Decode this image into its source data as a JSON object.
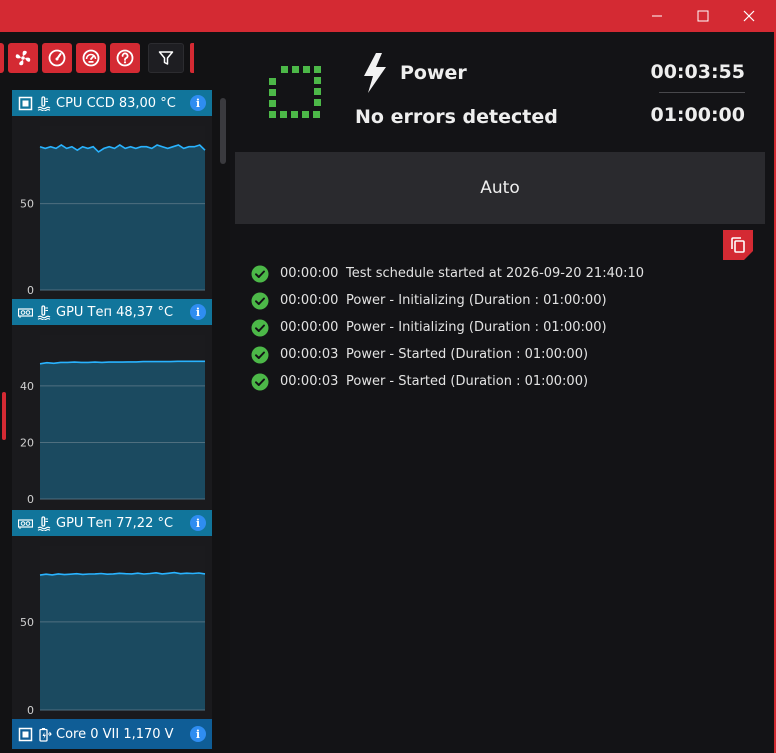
{
  "window": {
    "minimize_icon": "minimize-icon",
    "maximize_icon": "maximize-icon",
    "close_icon": "close-icon",
    "accent": "#d42a33"
  },
  "toolbar": {
    "icons": [
      "fan-icon",
      "gauge-icon",
      "speedometer-icon",
      "help-icon",
      "filter-icon"
    ]
  },
  "sensors": [
    {
      "icon": "cpu-chip-icon",
      "type_icon": "temperature-icon",
      "label": "CPU CCD 83,00 °C",
      "header_color": "#11759b",
      "ticks": [
        "50",
        "0"
      ]
    },
    {
      "icon": "gpu-card-icon",
      "type_icon": "temperature-icon",
      "label": "GPU Теп 48,37 °C",
      "header_color": "#11759b",
      "ticks": [
        "40",
        "20",
        "0"
      ]
    },
    {
      "icon": "gpu-card-icon",
      "type_icon": "temperature-icon",
      "label": "GPU Теп 77,22 °C",
      "header_color": "#11759b",
      "ticks": [
        "50",
        "0"
      ]
    },
    {
      "icon": "cpu-chip-icon",
      "type_icon": "battery-icon",
      "label": "Core 0 VII 1,170 V",
      "header_color": "#0f5d96"
    }
  ],
  "chart_data": [
    {
      "type": "line",
      "series_color": "#29b3ff",
      "ylim": [
        0,
        95
      ],
      "y": [
        83,
        82,
        83,
        82,
        84,
        82,
        83,
        81,
        83,
        82,
        83,
        80,
        82,
        83,
        82,
        84,
        82,
        83,
        82,
        83,
        83,
        82,
        84,
        83,
        82,
        83,
        84,
        82,
        83,
        83,
        84,
        81
      ]
    },
    {
      "type": "line",
      "series_color": "#29b3ff",
      "ylim": [
        0,
        58
      ],
      "y": [
        47.8,
        48.2,
        48.0,
        48.3,
        48.3,
        48.4,
        48.3,
        48.3,
        48.4,
        48.3,
        48.4,
        48.4,
        48.4,
        48.5,
        48.5,
        48.6,
        48.6,
        48.6,
        48.6,
        48.6,
        48.7,
        48.7,
        48.7,
        48.7,
        48.7
      ]
    },
    {
      "type": "line",
      "series_color": "#29b3ff",
      "ylim": [
        0,
        93
      ],
      "y": [
        76.5,
        77,
        76.6,
        77.2,
        76.8,
        77,
        77.3,
        76.9,
        77.1,
        77.2,
        77.4,
        77,
        77.2,
        77.5,
        77.3,
        77.2,
        77.6,
        77.1,
        77.4,
        77.8,
        77.2,
        77.5,
        77.9,
        77.3,
        77.6,
        77.4,
        77.7,
        77.2
      ]
    }
  ],
  "header": {
    "status_icon": "stopped-status-icon",
    "status_color": "#4cb848",
    "test_icon": "lightning-bolt-icon",
    "test_name": "Power",
    "error_status": "No errors detected",
    "elapsed": "00:03:55",
    "duration": "01:00:00"
  },
  "mode_button": {
    "label": "Auto"
  },
  "copy_icon": "copy-icon",
  "log": [
    {
      "time": "00:00:00",
      "message": "Test schedule started at 2026-09-20 21:40:10"
    },
    {
      "time": "00:00:00",
      "message": "Power - Initializing (Duration : 01:00:00)"
    },
    {
      "time": "00:00:00",
      "message": "Power - Initializing (Duration : 01:00:00)"
    },
    {
      "time": "00:00:03",
      "message": "Power - Started (Duration : 01:00:00)"
    },
    {
      "time": "00:00:03",
      "message": "Power - Started (Duration : 01:00:00)"
    }
  ]
}
